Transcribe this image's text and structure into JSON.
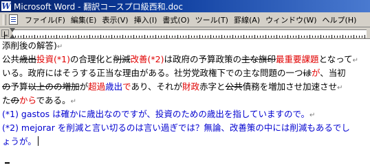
{
  "window": {
    "title": "Microsoft Word - 翻訳コースプロ級西和.doc"
  },
  "menu": [
    "ファイル(F)",
    "編集(E)",
    "表示(V)",
    "挿入(I)",
    "書式(O)",
    "ツール(T)",
    "罫線(A)",
    "ウィンドウ(W)",
    "ヘルプ(H)"
  ],
  "doc": {
    "l0": "添削後の解答)",
    "l1": [
      {
        "t": "公共",
        "s": ""
      },
      {
        "t": "歳出",
        "s": "del"
      },
      {
        "t": "投資(*1)",
        "s": "red"
      },
      {
        "t": "の合理化と",
        "s": ""
      },
      {
        "t": "削減",
        "s": "del"
      },
      {
        "t": "改善(*2)",
        "s": "red"
      },
      {
        "t": "は政府の予算政策の",
        "s": ""
      },
      {
        "t": "主な",
        "s": "del"
      },
      {
        "t": "旗印",
        "s": "del"
      },
      {
        "t": "最重要課題",
        "s": "red"
      },
      {
        "t": "となって",
        "s": ""
      }
    ],
    "l2": "いる。政府にはそうする正当な理由がある。社労党政権下での主な問題の一つ",
    "l2b": [
      {
        "t": "は",
        "s": "del"
      },
      {
        "t": "が",
        "s": "red"
      },
      {
        "t": "、当初",
        "s": ""
      }
    ],
    "l3": [
      {
        "t": "の",
        "s": "del"
      },
      {
        "t": "予算",
        "s": ""
      },
      {
        "t": "以上の",
        "s": "del"
      },
      {
        "t": "の",
        "s": "del"
      },
      {
        "t": "増加",
        "s": "del"
      },
      {
        "t": "が",
        "s": ""
      },
      {
        "t": "超過",
        "s": "red"
      },
      {
        "t": "歳出",
        "s": "blue"
      },
      {
        "t": "で",
        "s": "red"
      },
      {
        "t": "あり、それが",
        "s": ""
      },
      {
        "t": "財政",
        "s": "red"
      },
      {
        "t": "赤字と",
        "s": ""
      },
      {
        "t": "公共",
        "s": "del"
      },
      {
        "t": "債務を増加させ加速させ",
        "s": ""
      }
    ],
    "l4": [
      {
        "t": "た",
        "s": ""
      },
      {
        "t": "の",
        "s": "del"
      },
      {
        "t": "から",
        "s": "red"
      },
      {
        "t": "である。",
        "s": ""
      }
    ],
    "n1": "(*1) gastos は確かに歳出なのですが、投資のための歳出を指していますので。",
    "n2a": "(*2) mejorar を削減と言い切るのは言い過ぎでは？無論、改善策の中には削減もあるでし",
    "n2b": "ょうが。"
  }
}
